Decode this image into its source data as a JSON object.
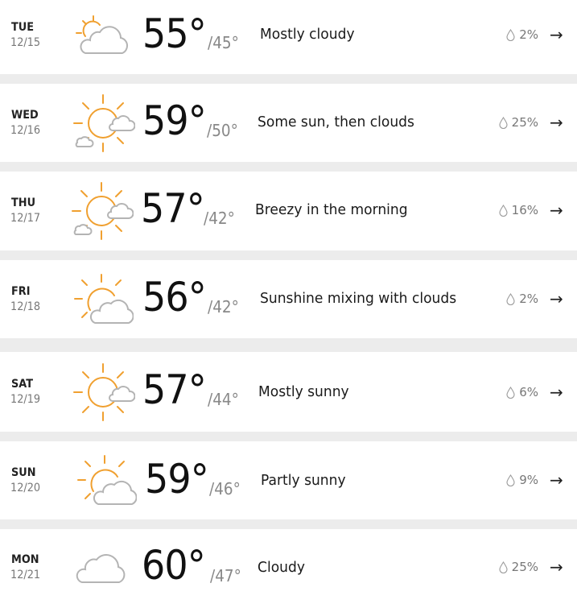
{
  "forecast": [
    {
      "day": "TUE",
      "date": "12/15",
      "icon": "mostly-cloudy-icon",
      "high": "55°",
      "low": "/45°",
      "description": "Mostly cloudy",
      "precip": "2%"
    },
    {
      "day": "WED",
      "date": "12/16",
      "icon": "partly-sunny-icon",
      "high": "59°",
      "low": "/50°",
      "description": "Some sun, then clouds",
      "precip": "25%"
    },
    {
      "day": "THU",
      "date": "12/17",
      "icon": "partly-sunny-icon",
      "high": "57°",
      "low": "/42°",
      "description": "Breezy in the morning",
      "precip": "16%"
    },
    {
      "day": "FRI",
      "date": "12/18",
      "icon": "sun-cloud-icon",
      "high": "56°",
      "low": "/42°",
      "description": "Sunshine mixing with clouds",
      "precip": "2%"
    },
    {
      "day": "SAT",
      "date": "12/19",
      "icon": "mostly-sunny-icon",
      "high": "57°",
      "low": "/44°",
      "description": "Mostly sunny",
      "precip": "6%"
    },
    {
      "day": "SUN",
      "date": "12/20",
      "icon": "sun-cloud-icon",
      "high": "59°",
      "low": "/46°",
      "description": "Partly sunny",
      "precip": "9%"
    },
    {
      "day": "MON",
      "date": "12/21",
      "icon": "cloudy-icon",
      "high": "60°",
      "low": "/47°",
      "description": "Cloudy",
      "precip": "25%"
    }
  ],
  "colors": {
    "sun": "#f0a030",
    "cloud": "#b4b4b4",
    "separator": "#ececec"
  }
}
